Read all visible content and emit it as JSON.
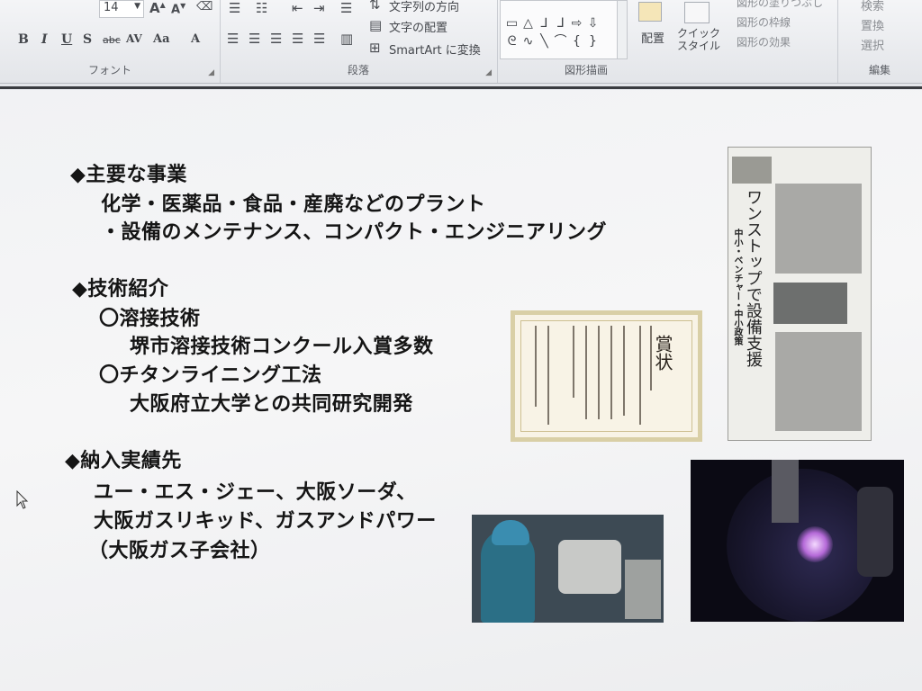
{
  "ribbon": {
    "font_size": "14",
    "format_buttons": [
      "B",
      "I",
      "U",
      "S",
      "abc",
      "AV",
      "Aa",
      "A"
    ],
    "groups": [
      {
        "label": "フォント"
      },
      {
        "label": "段落"
      },
      {
        "label": "図形描画"
      },
      {
        "label": "編集"
      }
    ],
    "text_direction_label": "文字列の方向",
    "align_text_label": "文字の配置",
    "smartart_label": "SmartArt に変換",
    "arrange_label": "配置",
    "quick_styles_label": "クイック\nスタイル",
    "shape_fill_label": "図形の塗りつぶし",
    "shape_outline_label": "図形の枠線",
    "shape_effects_label": "図形の効果",
    "find_label": "検索",
    "replace_label": "置換",
    "select_label": "選択"
  },
  "slide": {
    "section1_title": "◆主要な事業",
    "section1_line1": "化学・医薬品・食品・産廃などのプラント",
    "section1_line2": "・設備のメンテナンス、コンパクト・エンジニアリング",
    "section2_title": "◆技術紹介",
    "tech1_title": "〇溶接技術",
    "tech1_detail": "堺市溶接技術コンクール入賞多数",
    "tech2_title": "〇チタンライニング工法",
    "tech2_detail": "大阪府立大学との共同研究開発",
    "section3_title": "◆納入実績先",
    "clients_line1": "ユー・エス・ジェー、大阪ソーダ、",
    "clients_line2": "大阪ガスリキッド、ガスアンドパワー",
    "clients_line3": "（大阪ガス子会社）"
  },
  "images": {
    "certificate_title": "賞状",
    "newspaper_headline": "ワンストップで設備支援",
    "newspaper_subhead": "中小・ベンチャー・中小政策"
  }
}
